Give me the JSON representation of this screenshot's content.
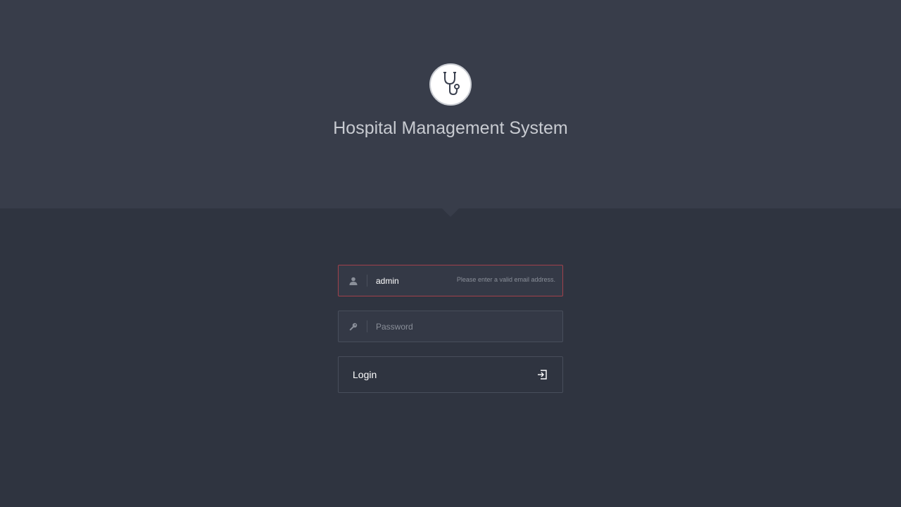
{
  "app": {
    "title": "Hospital Management System",
    "logo_icon": "stethoscope-icon"
  },
  "login_form": {
    "username": {
      "value": "admin",
      "icon": "user-icon",
      "validation_message": "Please enter a valid email address.",
      "state": "error"
    },
    "password": {
      "value": "",
      "placeholder": "Password",
      "icon": "key-icon"
    },
    "submit": {
      "label": "Login",
      "icon": "sign-in-icon"
    }
  },
  "colors": {
    "background": "#2f3440",
    "header_band": "#383d4a",
    "error_border": "#a1414b",
    "title_text": "#c8cbd1"
  }
}
